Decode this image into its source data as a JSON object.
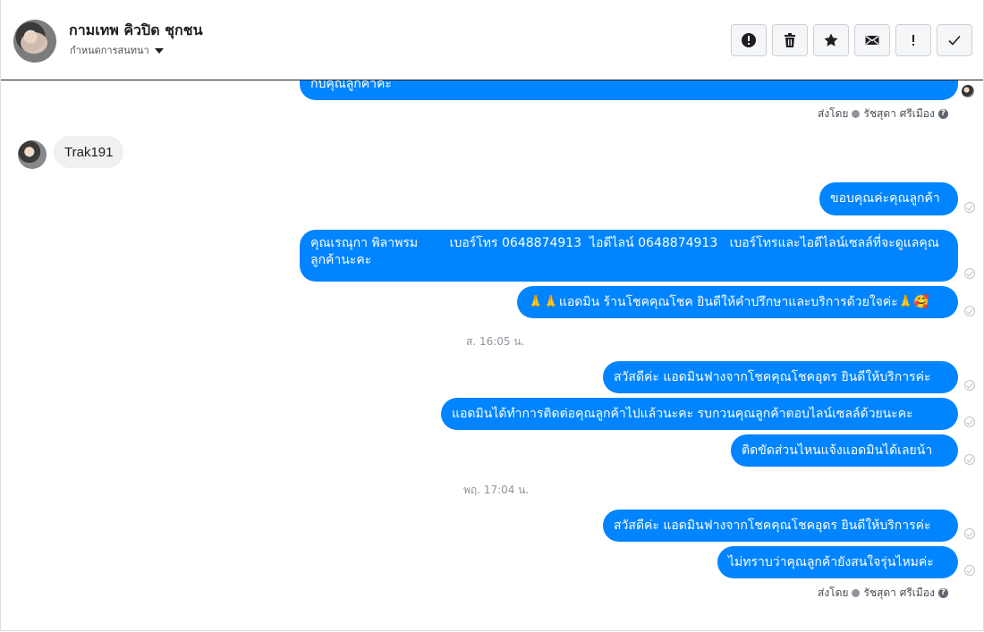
{
  "header": {
    "title": "กามเทพ คิวปิด ชุกชน",
    "subtitle": "กำหนดการสนทนา",
    "actions": [
      {
        "name": "spam-report-button",
        "icon": "alert-circle-icon"
      },
      {
        "name": "delete-button",
        "icon": "trash-icon"
      },
      {
        "name": "star-button",
        "icon": "star-icon"
      },
      {
        "name": "mark-unread-button",
        "icon": "envelope-icon"
      },
      {
        "name": "important-button",
        "icon": "exclamation-icon"
      },
      {
        "name": "mark-done-button",
        "icon": "checkmark-icon"
      }
    ]
  },
  "messages": {
    "partial_top": "กับคุณลูกค้าค่ะ",
    "sent_by_1": {
      "prefix": "ส่งโดย",
      "name": "รัชสุดา ศรีเมือง"
    },
    "incoming_1": "Trak191",
    "out_1": "ขอบคุณค่ะคุณลูกค้า",
    "out_2": "คุณเรณุกา พิลาพรม        เบอร์โทร 0648874913  ไอดีไลน์ 0648874913   เบอร์โทรและไอดีไลน์เซลล์ที่จะดูแลคุณลูกค้านะคะ",
    "out_3": "🙏🙏แอดมิน ร้านโชคคุณโชค ยินดีให้คำปรึกษาและบริการด้วยใจค่ะ🙏🥰",
    "time_1": "ส. 16:05 น.",
    "out_4": "สวัสดีค่ะ แอดมินฟางจากโชคคุณโชคอุดร ยินดีให้บริการค่ะ",
    "out_5": "แอดมินได้ทำการติดต่อคุณลูกค้าไปแล้วนะคะ  รบกวนคุณลูกค้าตอบไลน์เซลล์ด้วยนะคะ",
    "out_6": "ติดขัดส่วนไหนแจ้งแอดมินได้เลยน้า",
    "time_2": "พฤ. 17:04 น.",
    "out_7": "สวัสดีค่ะ แอดมินฟางจากโชคคุณโชคอุดร ยินดีให้บริการค่ะ",
    "out_8": "ไม่ทราบว่าคุณลูกค้ายังสนใจรุ่นไหมค่ะ",
    "sent_by_2": {
      "prefix": "ส่งโดย",
      "name": "รัชสุดา ศรีเมือง"
    }
  },
  "colors": {
    "bubble_out": "#0084ff",
    "bubble_in": "#f1f0f0",
    "header_border": "#1c1e21"
  }
}
